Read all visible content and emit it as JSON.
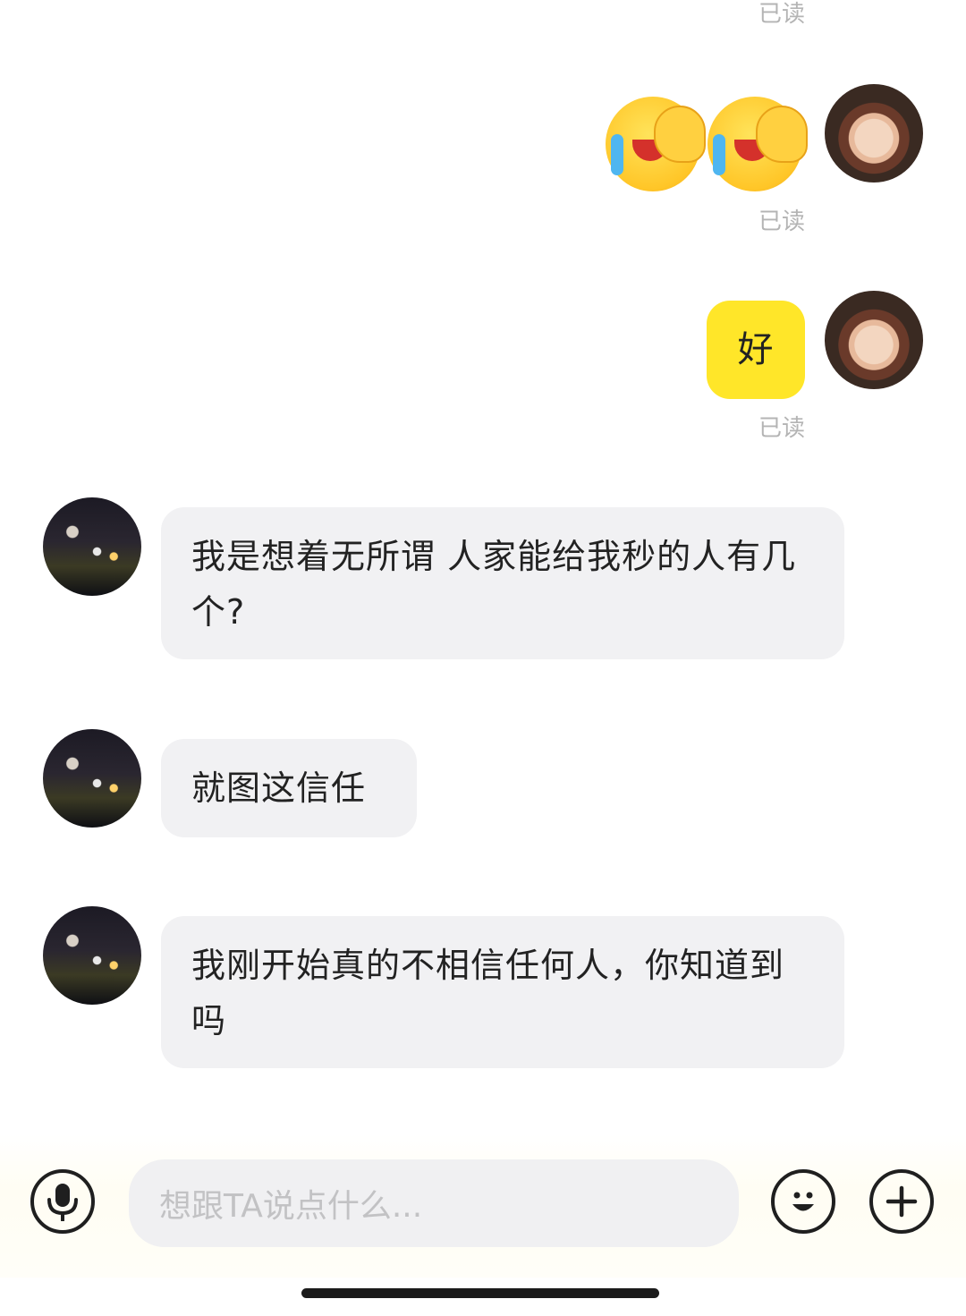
{
  "messages": {
    "read_label_top": "已读",
    "read_label_emoji": "已读",
    "read_label_hao": "已读",
    "self_hao_text": "好",
    "other_msg_1": "我是想着无所谓  人家能给我秒的人有几个?",
    "other_msg_2": "就图这信任",
    "other_msg_3": "我刚开始真的不相信任何人，你知道到吗"
  },
  "emoji_message": {
    "icons": [
      "loudly-crying-face-icon",
      "loudly-crying-face-icon"
    ]
  },
  "input_bar": {
    "placeholder": "想跟TA说点什么...",
    "voice_icon": "microphone-icon",
    "emoji_icon": "smiley-face-icon",
    "add_icon": "plus-icon"
  },
  "colors": {
    "self_bubble": "#ffe629",
    "other_bubble": "#f1f1f3",
    "read_text": "#b4b4b4"
  }
}
